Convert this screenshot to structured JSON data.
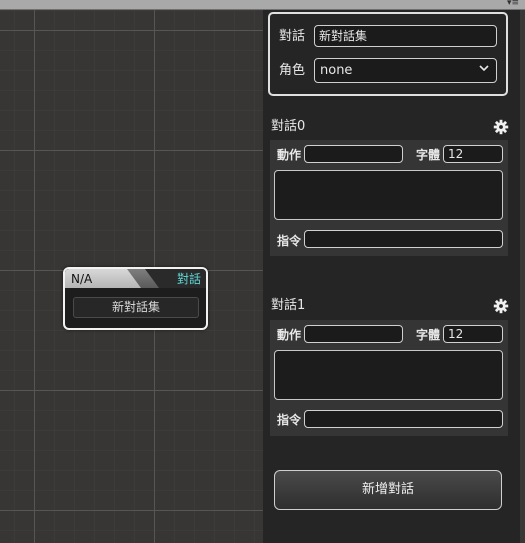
{
  "topbar": {
    "menu_icon": "dropdown-menu-icon",
    "menu_glyph": "▾≡"
  },
  "node": {
    "title": "N/A",
    "type_label": "對話",
    "body_label": "新對話集",
    "type_color": "#5fd6d6"
  },
  "inspector": {
    "name_label": "對話",
    "name_value": "新對話集",
    "role_label": "角色",
    "role_value": "none"
  },
  "dialogs": [
    {
      "title": "對話0",
      "action_label": "動作",
      "action_value": "",
      "font_label": "字體",
      "font_value": "12",
      "text_value": "",
      "command_label": "指令",
      "command_value": ""
    },
    {
      "title": "對話1",
      "action_label": "動作",
      "action_value": "",
      "font_label": "字體",
      "font_value": "12",
      "text_value": "",
      "command_label": "指令",
      "command_value": ""
    }
  ],
  "add_dialog_label": "新增對話"
}
